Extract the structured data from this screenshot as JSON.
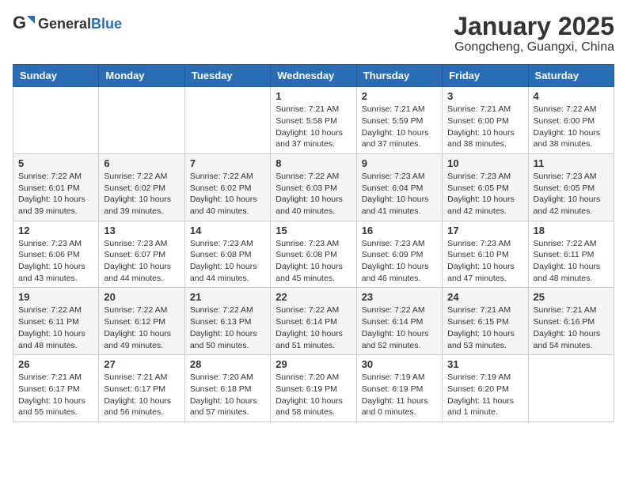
{
  "header": {
    "logo_general": "General",
    "logo_blue": "Blue",
    "month_title": "January 2025",
    "subtitle": "Gongcheng, Guangxi, China"
  },
  "weekdays": [
    "Sunday",
    "Monday",
    "Tuesday",
    "Wednesday",
    "Thursday",
    "Friday",
    "Saturday"
  ],
  "weeks": [
    [
      {
        "day": "",
        "info": ""
      },
      {
        "day": "",
        "info": ""
      },
      {
        "day": "",
        "info": ""
      },
      {
        "day": "1",
        "info": "Sunrise: 7:21 AM\nSunset: 5:58 PM\nDaylight: 10 hours\nand 37 minutes."
      },
      {
        "day": "2",
        "info": "Sunrise: 7:21 AM\nSunset: 5:59 PM\nDaylight: 10 hours\nand 37 minutes."
      },
      {
        "day": "3",
        "info": "Sunrise: 7:21 AM\nSunset: 6:00 PM\nDaylight: 10 hours\nand 38 minutes."
      },
      {
        "day": "4",
        "info": "Sunrise: 7:22 AM\nSunset: 6:00 PM\nDaylight: 10 hours\nand 38 minutes."
      }
    ],
    [
      {
        "day": "5",
        "info": "Sunrise: 7:22 AM\nSunset: 6:01 PM\nDaylight: 10 hours\nand 39 minutes."
      },
      {
        "day": "6",
        "info": "Sunrise: 7:22 AM\nSunset: 6:02 PM\nDaylight: 10 hours\nand 39 minutes."
      },
      {
        "day": "7",
        "info": "Sunrise: 7:22 AM\nSunset: 6:02 PM\nDaylight: 10 hours\nand 40 minutes."
      },
      {
        "day": "8",
        "info": "Sunrise: 7:22 AM\nSunset: 6:03 PM\nDaylight: 10 hours\nand 40 minutes."
      },
      {
        "day": "9",
        "info": "Sunrise: 7:23 AM\nSunset: 6:04 PM\nDaylight: 10 hours\nand 41 minutes."
      },
      {
        "day": "10",
        "info": "Sunrise: 7:23 AM\nSunset: 6:05 PM\nDaylight: 10 hours\nand 42 minutes."
      },
      {
        "day": "11",
        "info": "Sunrise: 7:23 AM\nSunset: 6:05 PM\nDaylight: 10 hours\nand 42 minutes."
      }
    ],
    [
      {
        "day": "12",
        "info": "Sunrise: 7:23 AM\nSunset: 6:06 PM\nDaylight: 10 hours\nand 43 minutes."
      },
      {
        "day": "13",
        "info": "Sunrise: 7:23 AM\nSunset: 6:07 PM\nDaylight: 10 hours\nand 44 minutes."
      },
      {
        "day": "14",
        "info": "Sunrise: 7:23 AM\nSunset: 6:08 PM\nDaylight: 10 hours\nand 44 minutes."
      },
      {
        "day": "15",
        "info": "Sunrise: 7:23 AM\nSunset: 6:08 PM\nDaylight: 10 hours\nand 45 minutes."
      },
      {
        "day": "16",
        "info": "Sunrise: 7:23 AM\nSunset: 6:09 PM\nDaylight: 10 hours\nand 46 minutes."
      },
      {
        "day": "17",
        "info": "Sunrise: 7:23 AM\nSunset: 6:10 PM\nDaylight: 10 hours\nand 47 minutes."
      },
      {
        "day": "18",
        "info": "Sunrise: 7:22 AM\nSunset: 6:11 PM\nDaylight: 10 hours\nand 48 minutes."
      }
    ],
    [
      {
        "day": "19",
        "info": "Sunrise: 7:22 AM\nSunset: 6:11 PM\nDaylight: 10 hours\nand 48 minutes."
      },
      {
        "day": "20",
        "info": "Sunrise: 7:22 AM\nSunset: 6:12 PM\nDaylight: 10 hours\nand 49 minutes."
      },
      {
        "day": "21",
        "info": "Sunrise: 7:22 AM\nSunset: 6:13 PM\nDaylight: 10 hours\nand 50 minutes."
      },
      {
        "day": "22",
        "info": "Sunrise: 7:22 AM\nSunset: 6:14 PM\nDaylight: 10 hours\nand 51 minutes."
      },
      {
        "day": "23",
        "info": "Sunrise: 7:22 AM\nSunset: 6:14 PM\nDaylight: 10 hours\nand 52 minutes."
      },
      {
        "day": "24",
        "info": "Sunrise: 7:21 AM\nSunset: 6:15 PM\nDaylight: 10 hours\nand 53 minutes."
      },
      {
        "day": "25",
        "info": "Sunrise: 7:21 AM\nSunset: 6:16 PM\nDaylight: 10 hours\nand 54 minutes."
      }
    ],
    [
      {
        "day": "26",
        "info": "Sunrise: 7:21 AM\nSunset: 6:17 PM\nDaylight: 10 hours\nand 55 minutes."
      },
      {
        "day": "27",
        "info": "Sunrise: 7:21 AM\nSunset: 6:17 PM\nDaylight: 10 hours\nand 56 minutes."
      },
      {
        "day": "28",
        "info": "Sunrise: 7:20 AM\nSunset: 6:18 PM\nDaylight: 10 hours\nand 57 minutes."
      },
      {
        "day": "29",
        "info": "Sunrise: 7:20 AM\nSunset: 6:19 PM\nDaylight: 10 hours\nand 58 minutes."
      },
      {
        "day": "30",
        "info": "Sunrise: 7:19 AM\nSunset: 6:19 PM\nDaylight: 11 hours\nand 0 minutes."
      },
      {
        "day": "31",
        "info": "Sunrise: 7:19 AM\nSunset: 6:20 PM\nDaylight: 11 hours\nand 1 minute."
      },
      {
        "day": "",
        "info": ""
      }
    ]
  ]
}
